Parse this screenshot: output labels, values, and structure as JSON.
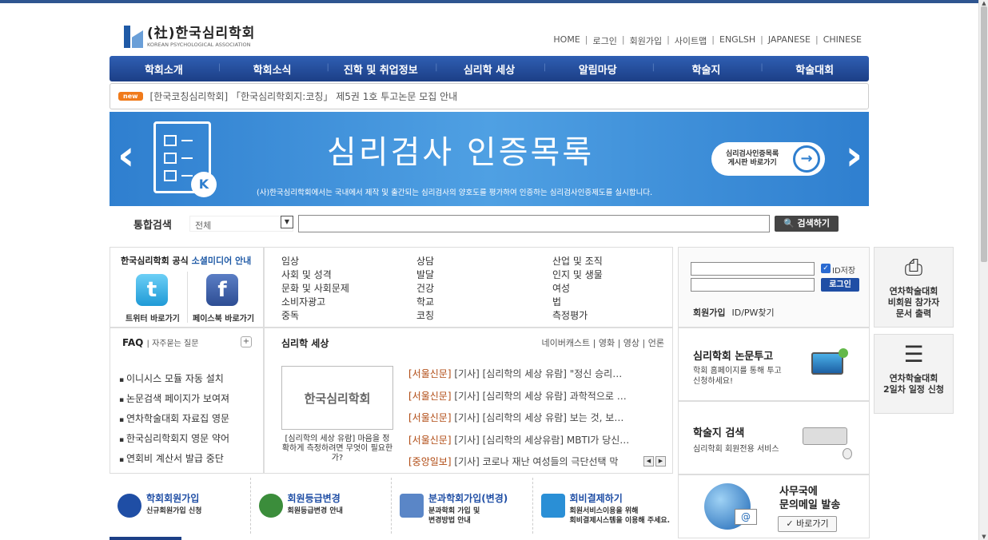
{
  "header": {
    "logo_kr": "(社)한국심리학회",
    "logo_en": "KOREAN PSYCHOLOGICAL ASSOCIATION",
    "top_menu": [
      "HOME",
      "로그인",
      "회원가입",
      "사이트맵",
      "ENGLSH",
      "JAPANESE",
      "CHINESE"
    ]
  },
  "gnb": [
    "학회소개",
    "학회소식",
    "진학 및 취업정보",
    "심리학 세상",
    "알림마당",
    "학술지",
    "학술대회"
  ],
  "notice": {
    "badge": "new",
    "text": "[한국코칭심리학회] 「한국심리학회지:코칭」 제5권 1호 투고논문 모집 안내"
  },
  "banner": {
    "title": "심리검사 인증목록",
    "subtitle": "(사)한국심리학회에서는 국내에서 제작 및 출간되는 심리검사의 양호도를 평가하여 인증하는 심리검사인증제도를 실시합니다.",
    "button_line1": "심리검사인증목록",
    "button_line2": "게시판 바로가기"
  },
  "search": {
    "label": "통합검색",
    "category": "전체",
    "button": "검색하기"
  },
  "social": {
    "title_prefix": "한국심리학회 공식 ",
    "title_highlight": "소셜미디어 안내",
    "twitter": "트위터 바로가기",
    "facebook": "페이스북 바로가기"
  },
  "categories": {
    "col1": [
      "임상",
      "사회 및 성격",
      "문화 및 사회문제",
      "소비자광고",
      "중독"
    ],
    "col2": [
      "상담",
      "발달",
      "건강",
      "학교",
      "코칭"
    ],
    "col3": [
      "산업 및 조직",
      "인지 및 생물",
      "여성",
      "법",
      "측정평가"
    ]
  },
  "faq": {
    "title": "FAQ",
    "subtitle": "자주묻는 질문",
    "items": [
      "이니시스 모듈 자동 설치",
      "논문검색 페이지가 보여져",
      "연차학술대회 자료집 영문",
      "한국심리학회지 영문 약어",
      "연회비 계산서 발급 중단"
    ]
  },
  "world": {
    "title": "심리학 세상",
    "links": "네이버캐스트 | 영화 | 영상 | 언론",
    "thumb_text": "한국심리학회",
    "caption": "[심리학의 세상 유람] 마음을 정확하게 측정하려면 무엇이 필요한가?",
    "items": [
      {
        "src": "[서울신문]",
        "text": " [기사] [심리학의 세상 유람] \"정신 승리…"
      },
      {
        "src": "[서울신문]",
        "text": " [기사] [심리학의 세상 유람] 과학적으로 …"
      },
      {
        "src": "[서울신문]",
        "text": " [기사] [심리학의 세상 유람] 보는 것, 보…"
      },
      {
        "src": "[서울신문]",
        "text": " [기사] [심리학의 세상유람] MBTI가 당신…"
      },
      {
        "src": "[중앙일보]",
        "text": " [기사] 코로나 재난 여성들의 극단선택 막"
      }
    ]
  },
  "login": {
    "save_id": "ID저장",
    "button": "로그인",
    "join": "회원가입",
    "find": "ID/PW찾기"
  },
  "side": {
    "print": "연차학술대회\n비회원 참가자\n문서 출력",
    "schedule": "연차학술대회\n2일차 일정 신청"
  },
  "paper": {
    "title": "심리학회 논문투고",
    "sub": "학회 홈페이지를 통해 투고\n신청하세요!"
  },
  "journal": {
    "title": "학술지 검색",
    "sub": "심리학회 회원전용 서비스"
  },
  "quick": [
    {
      "title": "학회회원가입",
      "sub": "신규회원가입 신청",
      "color": "#1f4ea5"
    },
    {
      "title": "회원등급변경",
      "sub": "회원등급변경 안내",
      "color": "#3b8d3b"
    },
    {
      "title": "분과학회가입(변경)",
      "sub": "분과학회 가입 및\n변경방법 안내",
      "color": "#5a86c7"
    },
    {
      "title": "회비결제하기",
      "sub": "회원서비스이용을 위해\n회비결제시스템을 이용해 주세요.",
      "color": "#2a8fd6"
    }
  ],
  "mail": {
    "title": "사무국에\n문의메일 발송",
    "button": "바로가기"
  }
}
